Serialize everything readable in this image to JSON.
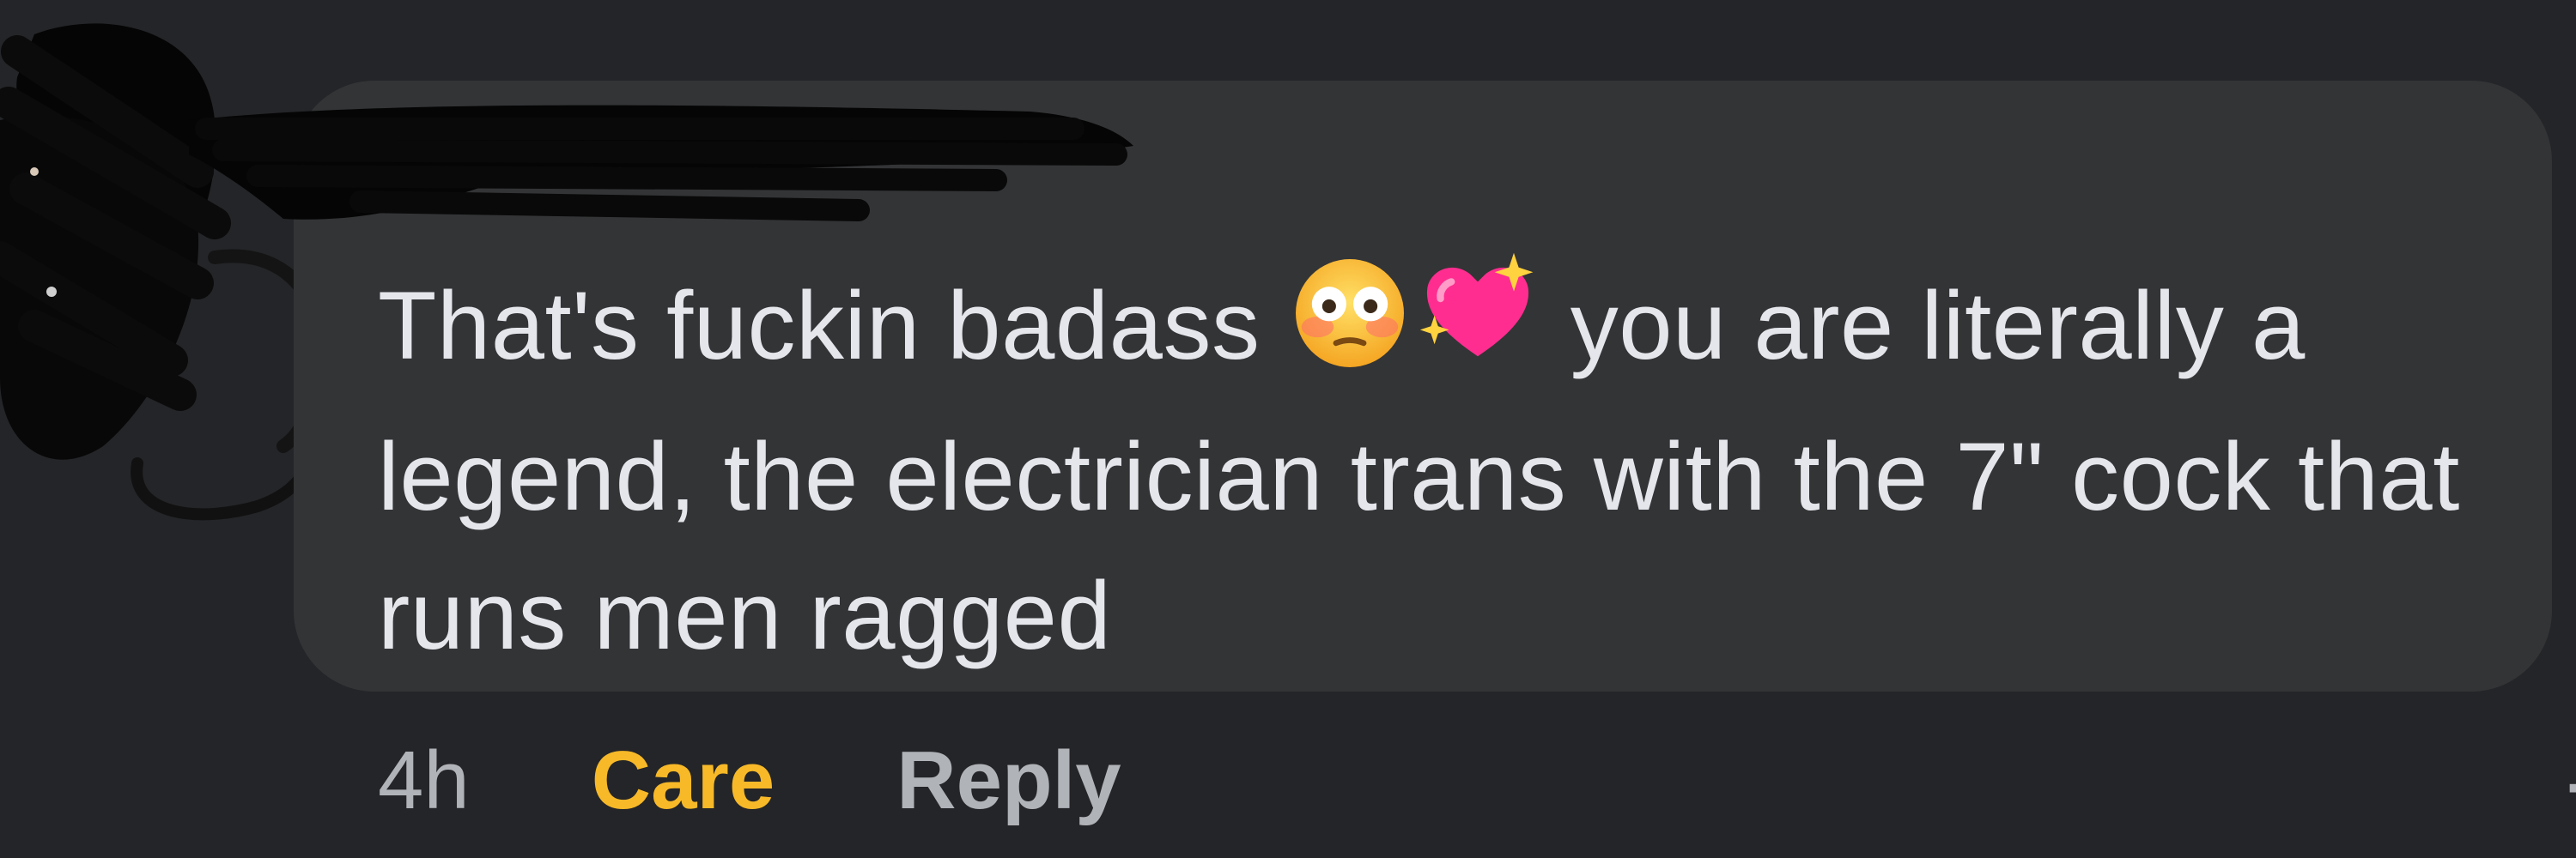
{
  "comment": {
    "text_before_emoji": "That's fuckin badass",
    "emojis": [
      "flushed-face-emoji",
      "sparkling-heart-emoji"
    ],
    "text_after_emoji": "you are literally a legend, the electrician trans with the 7\" cock that runs men ragged"
  },
  "actions": {
    "timestamp": "4h",
    "reaction_label": "Care",
    "reply_label": "Reply"
  },
  "colors": {
    "background": "#242528",
    "bubble": "#333436",
    "text": "#e4e6eb",
    "secondary_text": "#b0b3b8",
    "care_reaction": "#f7b928"
  }
}
